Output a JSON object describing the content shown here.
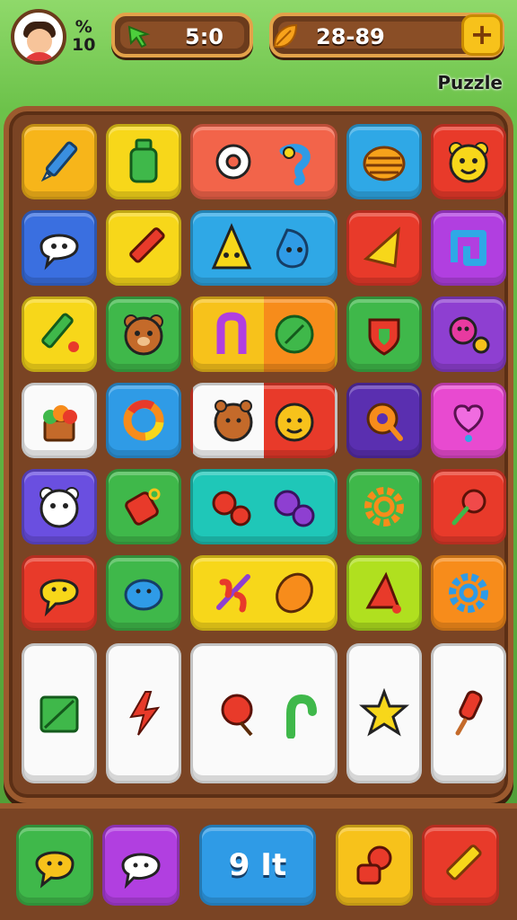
{
  "hud": {
    "percent_symbol": "%",
    "percent_value": "10",
    "timer_value": "5:0",
    "gems_value": "28-89",
    "add_label": "+",
    "mode_label": "Puzzle"
  },
  "icons": {
    "avatar": "player-avatar",
    "timer": "green-arrow-icon",
    "gems": "orange-leaf-icon",
    "add": "plus-icon"
  },
  "colors": {
    "yellow": "#f5c40f",
    "orange": "#f78c1b",
    "red": "#e83a2a",
    "blue": "#2f9be6",
    "purple": "#8e3fd1",
    "green": "#3fb84a",
    "white": "#fafafa"
  },
  "board": {
    "rows": [
      [
        "pencil",
        "bottle",
        "flower-pair",
        "beehive",
        "bear-face"
      ],
      [
        "ghost-face",
        "red-pencil",
        "cone-creatures",
        "horn",
        "square-link"
      ],
      [
        "green-pencil",
        "bear-face",
        "letter-and-leaf",
        "shield",
        "purple-critters"
      ],
      [
        "cupcake",
        "ring",
        "bear-pair",
        "whistle",
        "heart-balloon"
      ],
      [
        "bear-face-white",
        "tag",
        "gear-pair",
        "gear",
        "lollipop"
      ],
      [
        "speech-bubble",
        "turtle",
        "slash-and-seed",
        "horn-red",
        "gear-blue"
      ],
      [
        "leaf-box",
        "lightning",
        "lollipop-and-hook",
        "star",
        "ice-pop"
      ]
    ]
  },
  "tray": {
    "items": [
      "cat-face",
      "ghost",
      "number-blocks",
      "robot",
      "crayon"
    ],
    "center_label": "9 It"
  }
}
